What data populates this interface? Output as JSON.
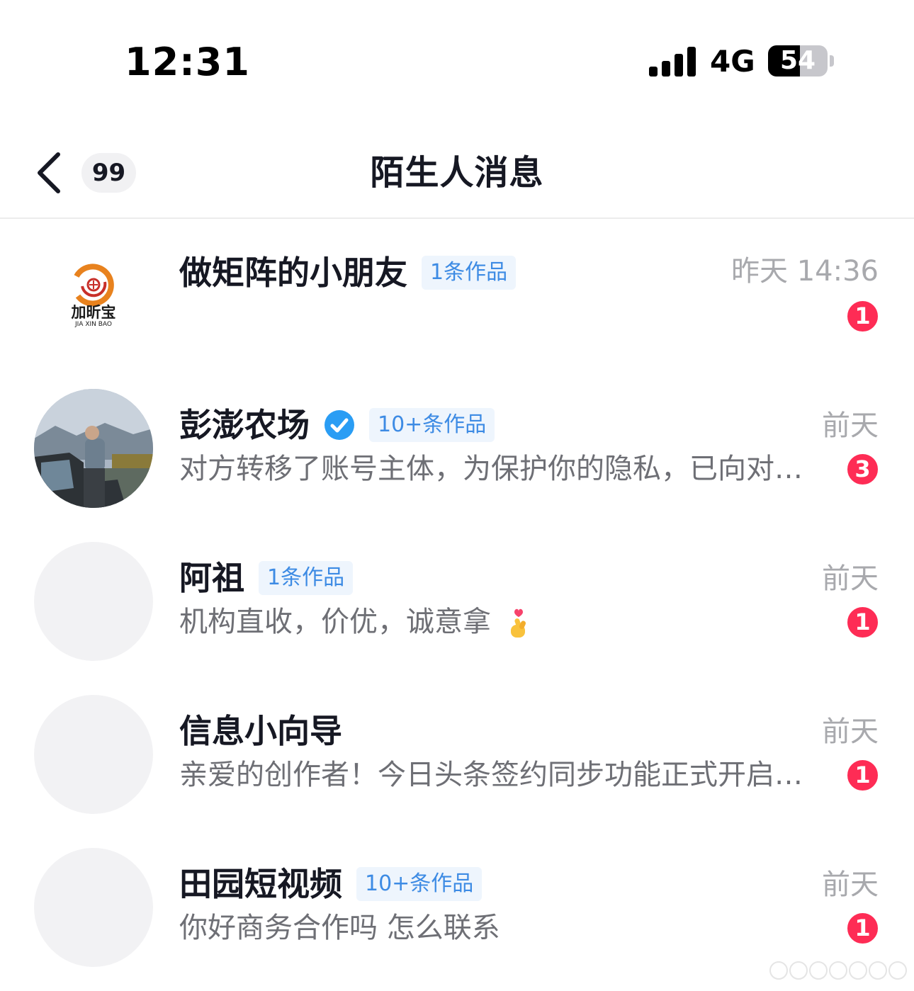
{
  "status_bar": {
    "time": "12:31",
    "network": "4G",
    "battery_level": "54"
  },
  "nav": {
    "unread_count": "99",
    "title": "陌生人消息"
  },
  "colors": {
    "badge": "#fe2c55",
    "tag_text": "#3d8be4",
    "tag_bg": "#eef5fd",
    "verified": "#2a9df4"
  },
  "conversations": [
    {
      "name": "做矩阵的小朋友",
      "works_tag": "1条作品",
      "time": "昨天 14:36",
      "preview": "",
      "unread": "1",
      "avatar": "jiaxinbao-logo",
      "logo_text": "加昕宝",
      "logo_subtext": "JIA XIN BAO"
    },
    {
      "name": "彭澎农场",
      "verified": true,
      "works_tag": "10+条作品",
      "time": "前天",
      "preview": "对方转移了账号主体，为保护你的隐私，已向对…",
      "unread": "3",
      "avatar": "photo-man-by-car"
    },
    {
      "name": "阿祖",
      "works_tag": "1条作品",
      "time": "前天",
      "preview": "机构直收，价优，诚意拿",
      "preview_emoji": "finger-heart-emoji",
      "unread": "1",
      "avatar": "blank"
    },
    {
      "name": "信息小向导",
      "works_tag": "",
      "time": "前天",
      "preview": "亲爱的创作者！今日头条签约同步功能正式开启…",
      "unread": "1",
      "avatar": "blank"
    },
    {
      "name": "田园短视频",
      "works_tag": "10+条作品",
      "time": "前天",
      "preview": "你好商务合作吗  怎么联系",
      "unread": "1",
      "avatar": "blank"
    }
  ]
}
